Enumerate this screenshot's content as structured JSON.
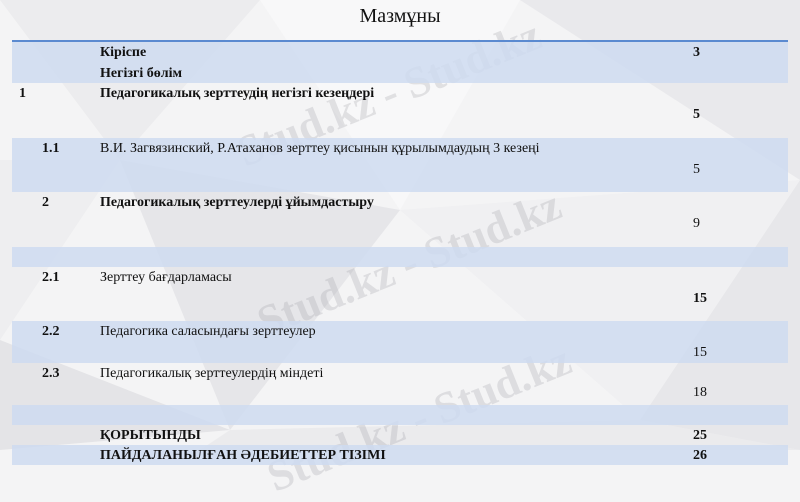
{
  "page_title": "Мазмұны",
  "watermark_text": "Stud.kz - Stud.kz",
  "colors": {
    "accent_line": "#5b8ad0",
    "row_shade": "#cddbf0",
    "background": "#f4f4f5"
  },
  "toc": [
    {
      "num": "",
      "title": "Кіріспе",
      "page": "3",
      "bold": true
    },
    {
      "num": "",
      "title": "Негізгі бөлім",
      "page": "",
      "bold": true
    },
    {
      "num": "1",
      "title": "Педагогикалық зерттеудің негізгі кезеңдері",
      "page": "5",
      "bold": true
    },
    {
      "num": "1.1",
      "title": "В.И. Загвязинский, Р.Атаханов зерттеу қисынын құрылымдаудың 3 кезеңі",
      "page": "5",
      "bold": false
    },
    {
      "num": "2",
      "title": "Педагогикалық зерттеулерді ұйымдастыру",
      "page": "9",
      "bold": true
    },
    {
      "num": "",
      "title": "",
      "page": "",
      "bold": false
    },
    {
      "num": "2.1",
      "title": "Зерттеу бағдарламасы",
      "page": "15",
      "bold": false
    },
    {
      "num": "2.2",
      "title": "Педагогика саласындағы зерттеулер",
      "page": "15",
      "bold": false
    },
    {
      "num": "2.3",
      "title": "Педагогикалық зерттеулердің міндеті",
      "page": "18",
      "bold": false
    },
    {
      "num": "",
      "title": "",
      "page": "",
      "bold": false
    },
    {
      "num": "",
      "title": "ҚОРЫТЫНДЫ",
      "page": "25",
      "bold": true
    },
    {
      "num": "",
      "title": "ПАЙДАЛАНЫЛҒАН ӘДЕБИЕТТЕР ТІЗІМІ",
      "page": "26",
      "bold": true
    }
  ]
}
